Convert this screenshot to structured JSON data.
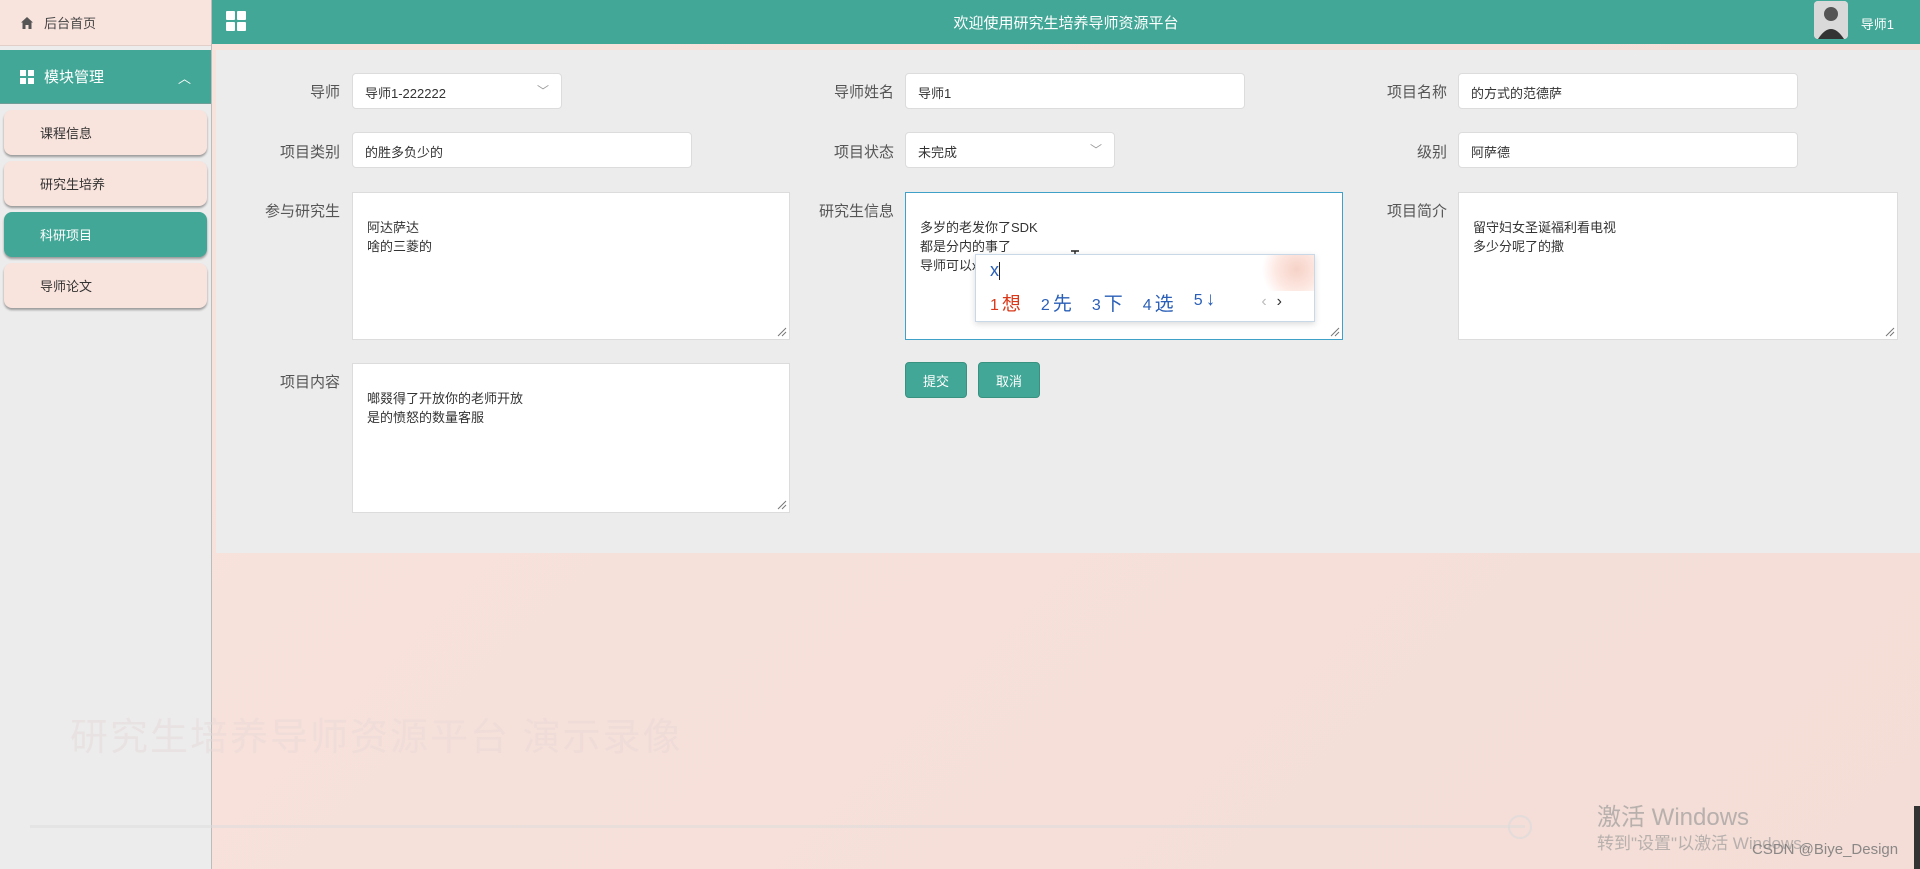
{
  "header": {
    "title": "欢迎使用研究生培养导师资源平台",
    "user_name": "导师1"
  },
  "sidebar": {
    "home_label": "后台首页",
    "module_label": "模块管理",
    "items": [
      {
        "label": "课程信息",
        "active": false
      },
      {
        "label": "研究生培养",
        "active": false
      },
      {
        "label": "科研项目",
        "active": true
      },
      {
        "label": "导师论文",
        "active": false
      }
    ]
  },
  "form": {
    "daoshi": {
      "label": "导师",
      "value": "导师1-222222"
    },
    "daoshi_name": {
      "label": "导师姓名",
      "value": "导师1"
    },
    "project_name": {
      "label": "项目名称",
      "value": "的方式的范德萨"
    },
    "project_type": {
      "label": "项目类别",
      "value": "的胜多负少的"
    },
    "project_status": {
      "label": "项目状态",
      "value": "未完成"
    },
    "level": {
      "label": "级别",
      "value": "阿萨德"
    },
    "participants": {
      "label": "参与研究生",
      "value": "阿达萨达\n啥的三菱的"
    },
    "student_info": {
      "label": "研究生信息",
      "value": "多岁的老发你了SDK\n都是分内的事了\n导师可以x"
    },
    "project_intro": {
      "label": "项目简介",
      "value": "留守妇女圣诞福利看电视\n多少分呢了的撒"
    },
    "project_content": {
      "label": "项目内容",
      "value": "啷叕得了开放你的老师开放\n是的愤怒的数量客服"
    },
    "submit_label": "提交",
    "cancel_label": "取消"
  },
  "ime": {
    "composition": "x",
    "candidates": [
      {
        "num": "1",
        "text": "想"
      },
      {
        "num": "2",
        "text": "先"
      },
      {
        "num": "3",
        "text": "下"
      },
      {
        "num": "4",
        "text": "选"
      },
      {
        "num": "5",
        "text": "↓"
      }
    ],
    "prev": "‹",
    "next": "›"
  },
  "overlay": {
    "ghost_text": "研究生培养导师资源平台 演示录像",
    "windows_line1": "激活 Windows",
    "windows_line2": "转到\"设置\"以激活 Windows。",
    "csdn": "CSDN @Biye_Design"
  },
  "colors": {
    "accent": "#42a796",
    "pink_bg": "#f9e3dd",
    "panel": "#ececec"
  }
}
